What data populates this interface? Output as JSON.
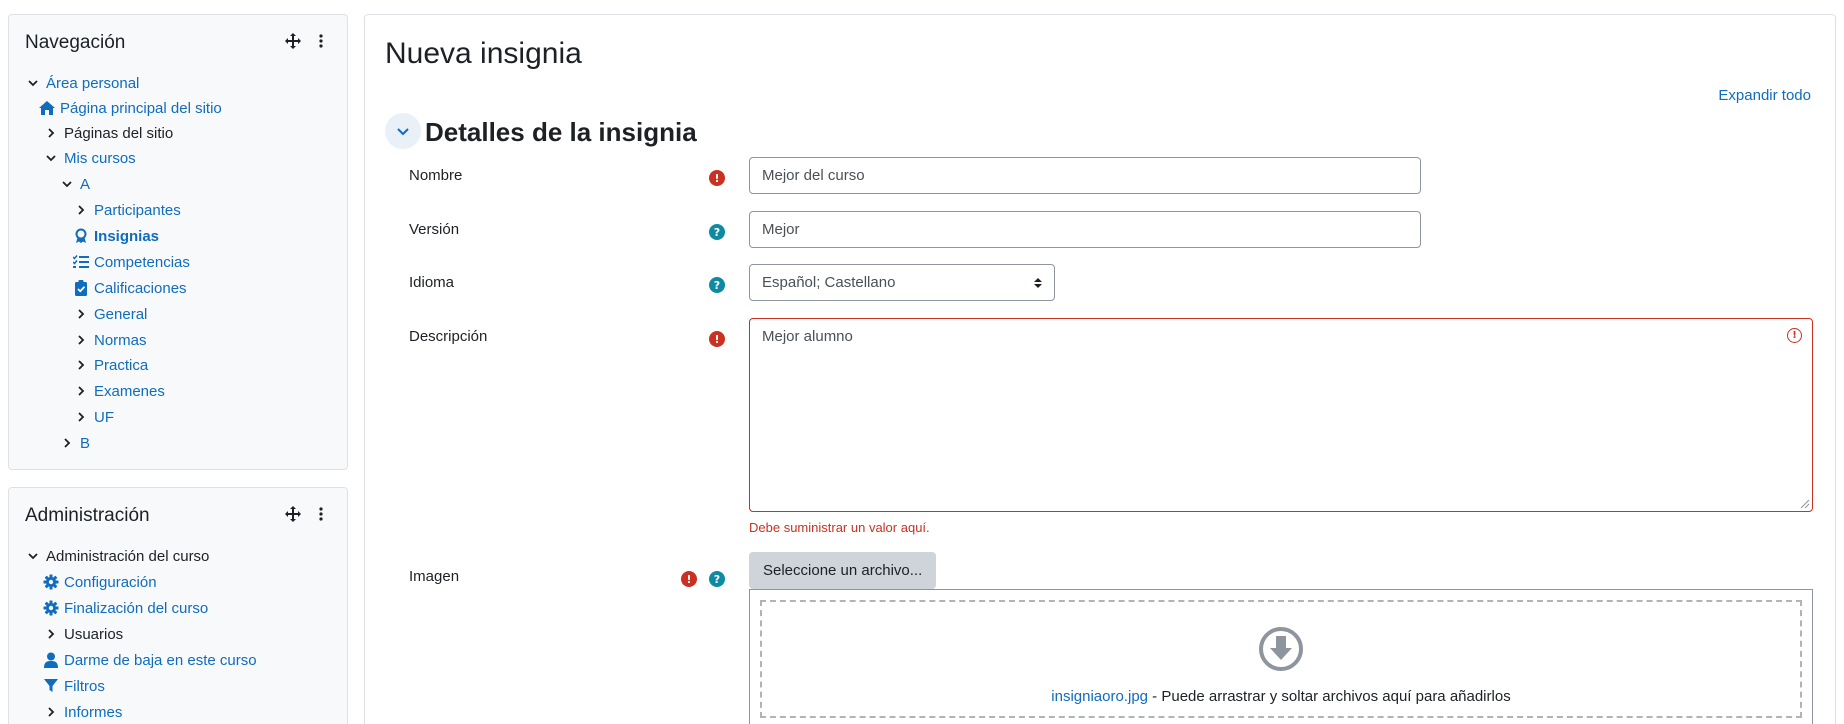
{
  "navigation": {
    "title": "Navegación",
    "items": [
      {
        "label": "Área personal"
      },
      {
        "label": "Página principal del sitio"
      },
      {
        "label": "Páginas del sitio"
      },
      {
        "label": "Mis cursos"
      },
      {
        "label": "A"
      },
      {
        "label": "Participantes"
      },
      {
        "label": "Insignias"
      },
      {
        "label": "Competencias"
      },
      {
        "label": "Calificaciones"
      },
      {
        "label": "General"
      },
      {
        "label": "Normas"
      },
      {
        "label": "Practica"
      },
      {
        "label": "Examenes"
      },
      {
        "label": "UF"
      },
      {
        "label": "B"
      }
    ]
  },
  "administration": {
    "title": "Administración",
    "items": [
      {
        "label": "Administración del curso"
      },
      {
        "label": "Configuración"
      },
      {
        "label": "Finalización del curso"
      },
      {
        "label": "Usuarios"
      },
      {
        "label": "Darme de baja en este curso"
      },
      {
        "label": "Filtros"
      },
      {
        "label": "Informes"
      }
    ]
  },
  "main": {
    "page_title": "Nueva insignia",
    "expand_all": "Expandir todo",
    "section_title": "Detalles de la insignia",
    "form": {
      "name": {
        "label": "Nombre",
        "value": "Mejor del curso"
      },
      "version": {
        "label": "Versión",
        "value": "Mejor"
      },
      "language": {
        "label": "Idioma",
        "value": "Español; Castellano"
      },
      "description": {
        "label": "Descripción",
        "value": "Mejor alumno",
        "error": "Debe suministrar un valor aquí."
      },
      "image": {
        "label": "Imagen",
        "button": "Seleccione un archivo...",
        "file_link": "insigniaoro.jpg",
        "drop_hint": " - Puede arrastrar y soltar archivos aquí para añadirlos"
      }
    }
  },
  "colors": {
    "link": "#0f6cbf",
    "required": "#ca3120",
    "help": "#0f8aa3"
  }
}
